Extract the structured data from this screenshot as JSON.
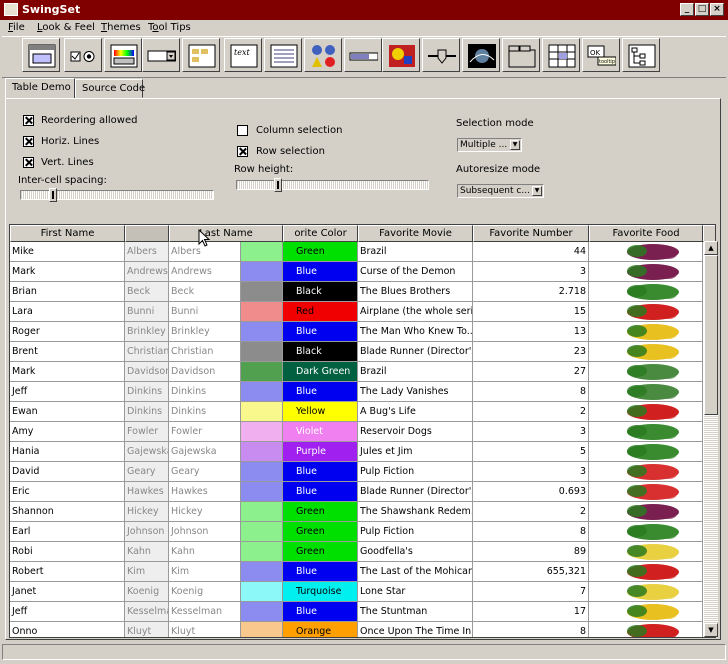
{
  "window": {
    "title": "SwingSet"
  },
  "menu": [
    {
      "pre": "",
      "u": "F",
      "post": "ile"
    },
    {
      "pre": "",
      "u": "L",
      "post": "ook & Feel"
    },
    {
      "pre": "",
      "u": "T",
      "post": "hemes"
    },
    {
      "pre": "T",
      "u": "o",
      "post": "ol Tips"
    }
  ],
  "toolbar": [
    "frame-demo-icon",
    "checkbox-radio-demo-icon",
    "color-chooser-icon",
    "combobox-icon",
    "file-chooser-icon",
    "text-edit-icon",
    "list-icon",
    "option-pane-icon",
    "progress-bar-icon",
    "scroll-pane-icon",
    "slider-icon",
    "split-pane-icon",
    "tabbed-pane-icon",
    "table-icon",
    "tooltip-icon",
    "tree-icon"
  ],
  "toolbar_tooltip_text": {
    "text": "text",
    "ok": "OK",
    "tooltip": "tooltip"
  },
  "tabs": [
    "Table Demo",
    "Source Code"
  ],
  "options": {
    "reordering": "Reordering allowed",
    "horiz_lines": "Horiz. Lines",
    "vert_lines": "Vert. Lines",
    "intercell": "Inter-cell spacing:",
    "column_selection": "Column selection",
    "row_selection": "Row selection",
    "row_height": "Row height:",
    "selection_mode_label": "Selection mode",
    "selection_mode_value": "Multiple ...",
    "autoresize_label": "Autoresize mode",
    "autoresize_value": "Subsequent c..."
  },
  "checkbox_states": {
    "reordering": true,
    "horiz_lines": true,
    "vert_lines": true,
    "column_selection": false,
    "row_selection": true
  },
  "slider_levels": {
    "intercell": 0.15,
    "row_height": 0.2
  },
  "table": {
    "headers": {
      "first": "First Name",
      "last": "Last Name",
      "color": "orite Color",
      "movie": "Favorite Movie",
      "number": "Favorite Number",
      "food": "Favorite Food"
    },
    "rows": [
      {
        "first": "Mike",
        "last": "Albers",
        "color": "Green",
        "swatch": "#8cf08c",
        "bg": "#00e000",
        "fg": "#000000",
        "movie": "Brazil",
        "num": "44",
        "food": "grapes"
      },
      {
        "first": "Mark",
        "last": "Andrews",
        "color": "Blue",
        "swatch": "#8c8cf0",
        "bg": "#0000f0",
        "fg": "#ffffff",
        "movie": "Curse of the Demon",
        "num": "3",
        "food": "grapes"
      },
      {
        "first": "Brian",
        "last": "Beck",
        "color": "Black",
        "swatch": "#8c8c8c",
        "bg": "#000000",
        "fg": "#ffffff",
        "movie": "The Blues Brothers",
        "num": "2.718",
        "food": "corn"
      },
      {
        "first": "Lara",
        "last": "Bunni",
        "color": "Red",
        "swatch": "#f08c8c",
        "bg": "#f00000",
        "fg": "#000000",
        "movie": "Airplane (the whole series)",
        "num": "15",
        "food": "strawberry"
      },
      {
        "first": "Roger",
        "last": "Brinkley",
        "color": "Blue",
        "swatch": "#8c8cf0",
        "bg": "#0000f0",
        "fg": "#ffffff",
        "movie": "The Man Who Knew To...",
        "num": "13",
        "food": "pepper"
      },
      {
        "first": "Brent",
        "last": "Christian",
        "color": "Black",
        "swatch": "#8c8c8c",
        "bg": "#000000",
        "fg": "#ffffff",
        "movie": "Blade Runner (Director's ...",
        "num": "23",
        "food": "pepper"
      },
      {
        "first": "Mark",
        "last": "Davidson",
        "color": "Dark Green",
        "swatch": "#50a050",
        "bg": "#006040",
        "fg": "#ffffff",
        "movie": "Brazil",
        "num": "27",
        "food": "asparagus"
      },
      {
        "first": "Jeff",
        "last": "Dinkins",
        "color": "Blue",
        "swatch": "#8c8cf0",
        "bg": "#0000f0",
        "fg": "#ffffff",
        "movie": "The Lady Vanishes",
        "num": "8",
        "food": "asparagus"
      },
      {
        "first": "Ewan",
        "last": "Dinkins",
        "color": "Yellow",
        "swatch": "#f8f88c",
        "bg": "#ffff00",
        "fg": "#000000",
        "movie": "A Bug's Life",
        "num": "2",
        "food": "strawberry"
      },
      {
        "first": "Amy",
        "last": "Fowler",
        "color": "Violet",
        "swatch": "#f0b0f0",
        "bg": "#f080f0",
        "fg": "#ffffff",
        "movie": "Reservoir Dogs",
        "num": "3",
        "food": "corn"
      },
      {
        "first": "Hania",
        "last": "Gajewska",
        "color": "Purple",
        "swatch": "#c88cf0",
        "bg": "#a020f0",
        "fg": "#ffffff",
        "movie": "Jules et Jim",
        "num": "5",
        "food": "corn"
      },
      {
        "first": "David",
        "last": "Geary",
        "color": "Blue",
        "swatch": "#8c8cf0",
        "bg": "#0000f0",
        "fg": "#ffffff",
        "movie": "Pulp Fiction",
        "num": "3",
        "food": "watermelon"
      },
      {
        "first": "Eric",
        "last": "Hawkes",
        "color": "Blue",
        "swatch": "#8c8cf0",
        "bg": "#0000f0",
        "fg": "#ffffff",
        "movie": "Blade Runner (Director's ...",
        "num": "0.693",
        "food": "watermelon"
      },
      {
        "first": "Shannon",
        "last": "Hickey",
        "color": "Green",
        "swatch": "#8cf08c",
        "bg": "#00e000",
        "fg": "#000000",
        "movie": "The Shawshank Redem...",
        "num": "2",
        "food": "grapes"
      },
      {
        "first": "Earl",
        "last": "Johnson",
        "color": "Green",
        "swatch": "#8cf08c",
        "bg": "#00e000",
        "fg": "#000000",
        "movie": "Pulp Fiction",
        "num": "8",
        "food": "corn"
      },
      {
        "first": "Robi",
        "last": "Kahn",
        "color": "Green",
        "swatch": "#8cf08c",
        "bg": "#00e000",
        "fg": "#000000",
        "movie": "Goodfella's",
        "num": "89",
        "food": "banana"
      },
      {
        "first": "Robert",
        "last": "Kim",
        "color": "Blue",
        "swatch": "#8c8cf0",
        "bg": "#0000f0",
        "fg": "#ffffff",
        "movie": "The Last of the Mohicans",
        "num": "655,321",
        "food": "strawberry"
      },
      {
        "first": "Janet",
        "last": "Koenig",
        "color": "Turquoise",
        "swatch": "#8cf8f8",
        "bg": "#00f0f0",
        "fg": "#000000",
        "movie": "Lone Star",
        "num": "7",
        "food": "banana"
      },
      {
        "first": "Jeff",
        "last": "Kesselman",
        "color": "Blue",
        "swatch": "#8c8cf0",
        "bg": "#0000f0",
        "fg": "#ffffff",
        "movie": "The Stuntman",
        "num": "17",
        "food": "pepper"
      },
      {
        "first": "Onno",
        "last": "Kluyt",
        "color": "Orange",
        "swatch": "#f8c88c",
        "bg": "#ffa000",
        "fg": "#000000",
        "movie": "Once Upon The Time In...",
        "num": "8",
        "food": "strawberry"
      }
    ]
  },
  "food_colors": {
    "grapes": "#7a2050",
    "corn": "#3a8a30",
    "strawberry": "#d02020",
    "pepper": "#e8c020",
    "asparagus": "#4a8a40",
    "watermelon": "#d83030",
    "banana": "#e8d040"
  }
}
